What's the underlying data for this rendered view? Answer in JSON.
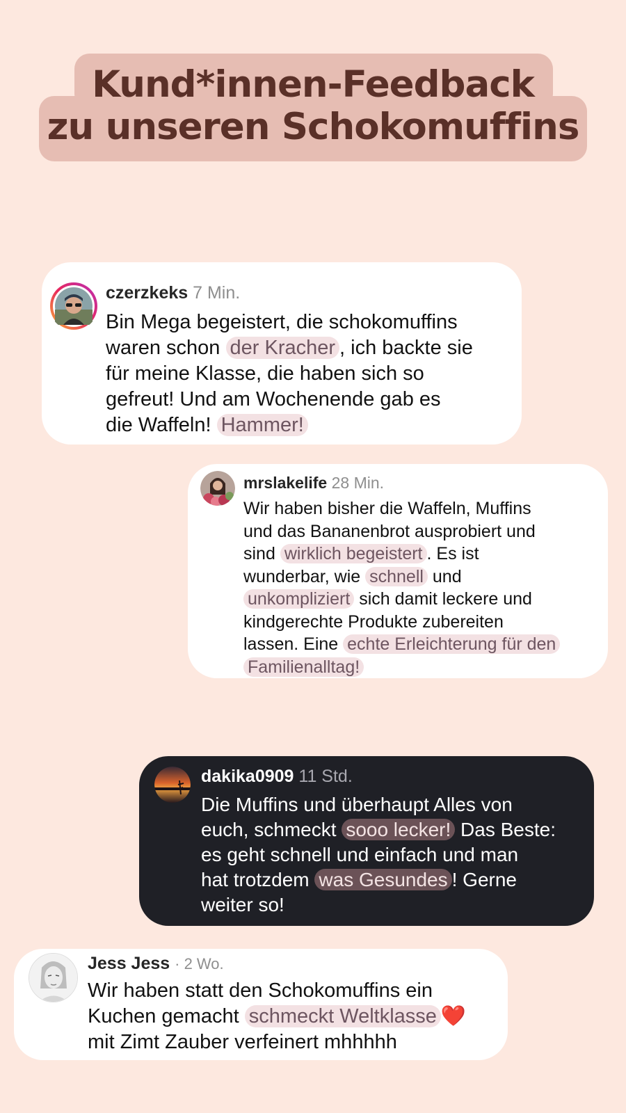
{
  "title": {
    "line1": "Kund*innen-Feedback",
    "line2": "zu unseren Schokomuffins"
  },
  "comments": [
    {
      "username": "czerzkeks",
      "time": "7 Min.",
      "avatar_icon": "user-avatar-sunglasses",
      "text": {
        "l1": "Bin Mega begeistert, die schokomuffins",
        "l2a": "waren schon ",
        "l2h": "der Kracher",
        "l2b": ", ich backte sie",
        "l3": "für meine Klasse, die haben sich so",
        "l4": "gefreut! Und am Wochenende gab es",
        "l5a": "die Waffeln! ",
        "l5h": "Hammer!"
      }
    },
    {
      "username": "mrslakelife",
      "time": "28 Min.",
      "avatar_icon": "user-avatar-flowers",
      "text": {
        "l1": "Wir haben bisher die Waffeln, Muffins",
        "l2": "und das Bananenbrot ausprobiert und",
        "l3a": "sind ",
        "l3h": "wirklich begeistert",
        "l3b": ". Es ist",
        "l4a": "wunderbar, wie ",
        "l4h": "schnell",
        "l4b": " und",
        "l5h": "unkompliziert",
        "l5b": " sich damit leckere und",
        "l6": "kindgerechte Produkte zubereiten",
        "l7a": "lassen. Eine ",
        "l7h": "echte Erleichterung für den",
        "l8h": "Familienalltag!"
      }
    },
    {
      "username": "dakika0909",
      "time": "11 Std.",
      "avatar_icon": "user-avatar-sunset",
      "text": {
        "l1": "Die Muffins und überhaupt Alles von",
        "l2a": "euch, schmeckt ",
        "l2h": "sooo lecker!",
        "l2b": " Das Beste:",
        "l3": "es geht schnell und einfach und man",
        "l4a": "hat trotzdem ",
        "l4h": "was Gesundes",
        "l4b": "! Gerne",
        "l5": "weiter so!"
      }
    },
    {
      "username": "Jess Jess",
      "time": "· 2 Wo.",
      "avatar_icon": "user-avatar-portrait",
      "text": {
        "l1": "Wir haben statt den Schokomuffins ein",
        "l2a": "Kuchen gemacht ",
        "l2h": "schmeckt Weltklasse",
        "l2emoji": "❤️",
        "l3": "mit Zimt Zauber verfeinert mhhhhh"
      }
    }
  ]
}
